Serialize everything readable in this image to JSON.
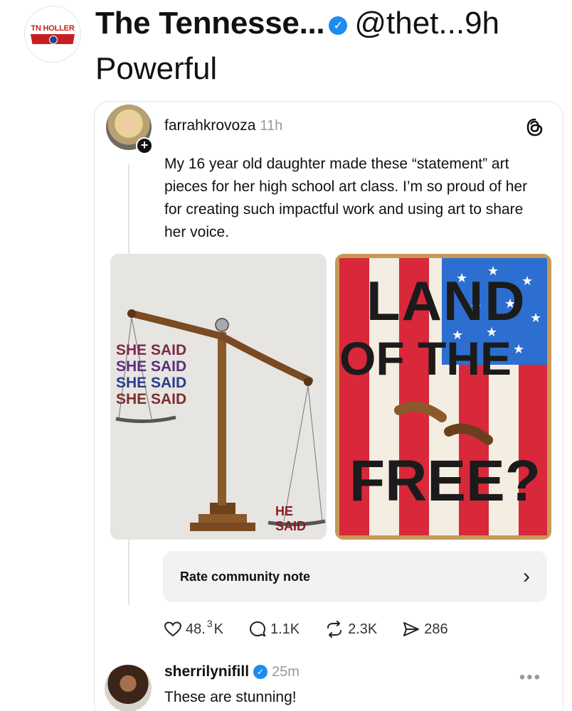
{
  "outer_post": {
    "avatar_logo_text": "TN HOLLER",
    "display_name": "The Tennesse...",
    "handle": "@thet...",
    "time": "9h",
    "text": "Powerful"
  },
  "quoted_post": {
    "username": "farrahkrovoza",
    "time": "11h",
    "body": "My 16 year old daughter made these “statement” art pieces for her high school art class. I’m so proud of her for creating such impactful work and using art to share her voice.",
    "art_left": {
      "she_said": [
        "SHE SAID",
        "SHE SAID",
        "SHE SAID",
        "SHE SAID"
      ],
      "he_said": "HE SAID"
    },
    "art_right": {
      "line1": "LAND",
      "line2": "OF THE",
      "line3": "FREE?"
    },
    "community_note_label": "Rate community note",
    "actions": {
      "likes_main": "48.",
      "likes_sup": "3",
      "likes_suffix": "K",
      "replies": "1.1K",
      "reposts": "2.3K",
      "shares": "286"
    }
  },
  "reply": {
    "username": "sherrilynifill",
    "time": "25m",
    "text": "These are stunning!"
  },
  "colors": {
    "verified": "#1d8cf0",
    "flag_red": "#d8283a",
    "flag_blue": "#2d6fd0"
  }
}
